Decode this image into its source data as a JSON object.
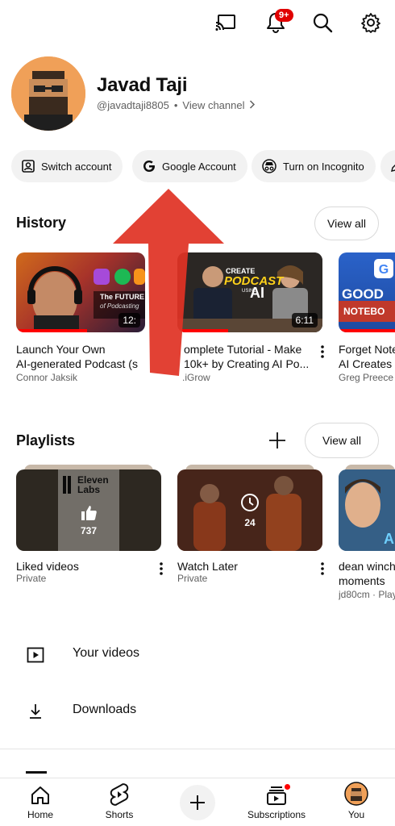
{
  "top_bar": {
    "cast_icon": "cast-icon",
    "notifications_badge": "9+",
    "search_icon": "search-icon",
    "settings_icon": "gear-icon"
  },
  "profile": {
    "name": "Javad Taji",
    "handle": "@javadtaji8805",
    "separator": "•",
    "view_channel": "View channel"
  },
  "chips": [
    {
      "label": "Switch account",
      "icon": "switch-account-icon"
    },
    {
      "label": "Google Account",
      "icon": "google-icon"
    },
    {
      "label": "Turn on Incognito",
      "icon": "incognito-icon"
    }
  ],
  "history": {
    "title": "History",
    "view_all": "View all",
    "items": [
      {
        "title_line1": "Launch Your Own",
        "title_line2": "AI-generated Podcast (s",
        "channel": "Connor Jaksik",
        "thumb_text_1": "The FUTURE",
        "thumb_text_2": "of Podcasting",
        "duration": "12:",
        "progress": 0.55
      },
      {
        "title_line1": "omplete Tutorial - Make",
        "title_line2": "10k+ by Creating AI Po...",
        "channel": ".iGrow",
        "thumb_text_1": "CREATE",
        "thumb_text_2": "PODCAST",
        "thumb_text_3": "USING",
        "thumb_text_4": "AI",
        "duration": "6:11",
        "progress": 0.35
      },
      {
        "title_line1": "Forget Note",
        "title_line2": "AI Creates",
        "channel": "Greg Preece",
        "thumb_text_1": "GOOD",
        "thumb_text_2": "NOTEBO",
        "progress": 1.0
      }
    ]
  },
  "playlists": {
    "title": "Playlists",
    "view_all": "View all",
    "items": [
      {
        "title": "Liked videos",
        "privacy": "Private",
        "count": "737",
        "thumb_text_1": "Eleven",
        "thumb_text_2": "Labs"
      },
      {
        "title": "Watch Later",
        "privacy": "Private",
        "count": "24"
      },
      {
        "title_line1": "dean winch",
        "title_line2": "moments",
        "channel": "jd80cm",
        "meta": "Play"
      }
    ]
  },
  "menu": [
    {
      "label": "Your videos",
      "icon": "play-square-icon"
    },
    {
      "label": "Downloads",
      "icon": "download-icon"
    }
  ],
  "bottom_nav": [
    {
      "label": "Home",
      "icon": "home-icon"
    },
    {
      "label": "Shorts",
      "icon": "shorts-icon"
    },
    {
      "label": "",
      "icon": "create-plus-icon"
    },
    {
      "label": "Subscriptions",
      "icon": "subscriptions-icon"
    },
    {
      "label": "You",
      "icon": "avatar"
    }
  ],
  "colors": {
    "accent_red": "#ff0000",
    "annotation_arrow": "#e03325",
    "chip_bg": "#f2f2f2",
    "text_secondary": "#606060"
  }
}
